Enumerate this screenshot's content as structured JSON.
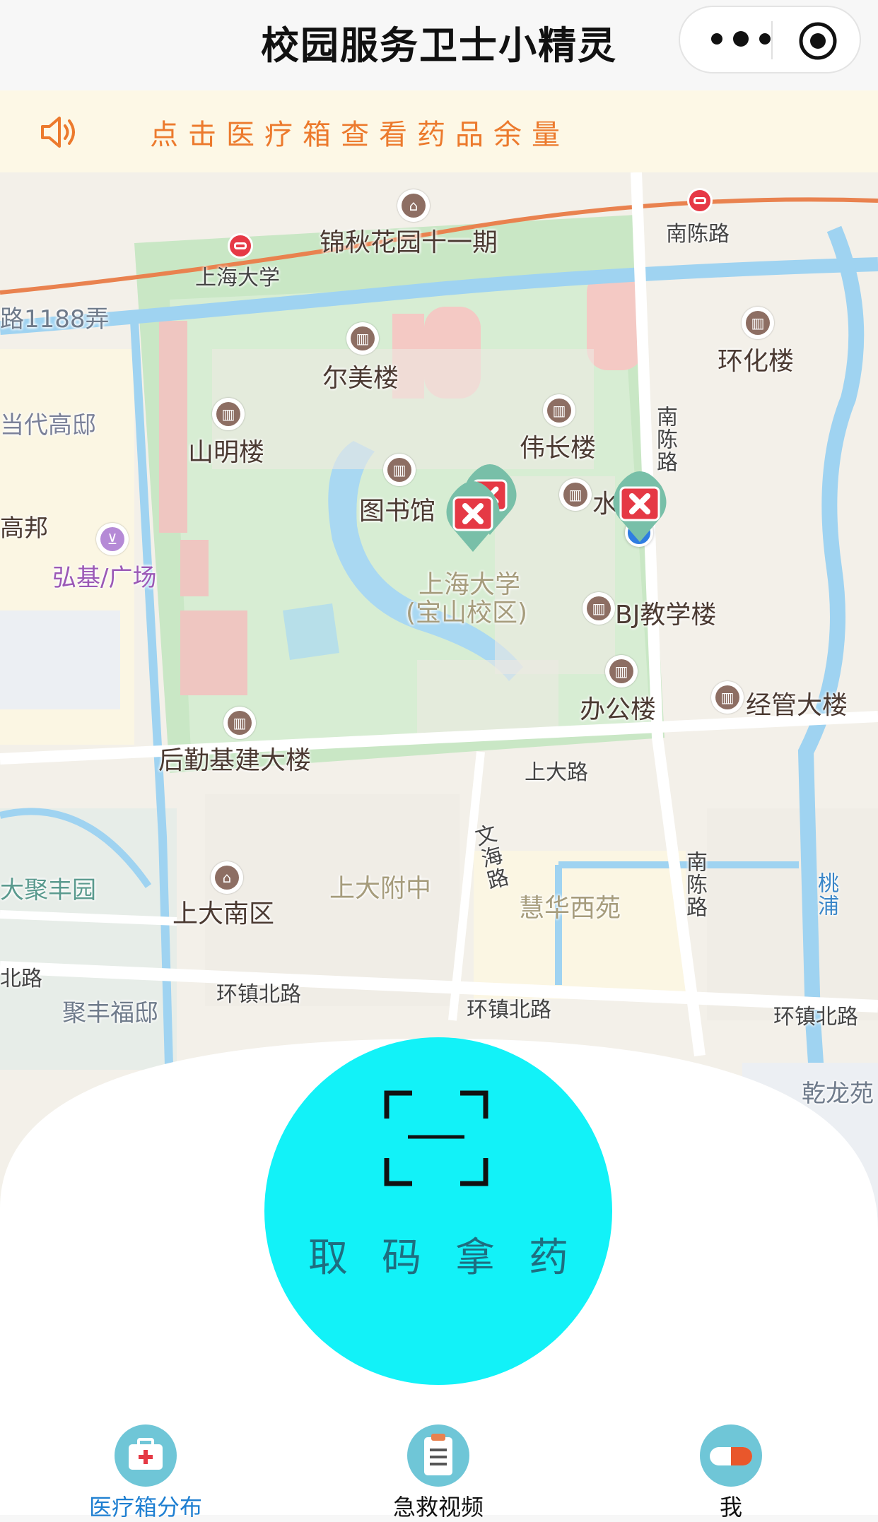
{
  "nav": {
    "title": "校园服务卫士小精灵"
  },
  "notice": {
    "text": "点击医疗箱查看药品余量"
  },
  "map": {
    "roads": {
      "huanzhen_north_left": "环镇北路",
      "huanzhen_north_middle": "环镇北路",
      "huanzhen_north_right": "环镇北路",
      "shangda_road": "上大路",
      "nanchen_road_top": "南陈路",
      "nanchen_road_vertical_upper": "南陈路",
      "nanchen_road_vertical_lower": "南陈路",
      "wenhai_road": "文海路",
      "lane_1188": "路1188弄",
      "left_road_stub": "北路",
      "taopu": "桃浦"
    },
    "places": {
      "jinqiu": "锦秋花园十一期",
      "shu_station": "上海大学",
      "ermei": "尔美楼",
      "shanming": "山明楼",
      "weichang": "伟长楼",
      "library": "图书馆",
      "shui": "水",
      "campus_line1": "上海大学",
      "campus_line2": "(宝山校区)",
      "bj": "BJ教学楼",
      "office": "办公楼",
      "jingguan": "经管大楼",
      "houqin": "后勤基建大楼",
      "huanhua": "环化楼",
      "dangdai": "当代高邸",
      "gaobang": "高邦",
      "hongji": "弘基/广场",
      "shangda_south": "上大南区",
      "shangda_fuzhong": "上大附中",
      "huihua": "慧华西苑",
      "dajufeng": "大聚丰园",
      "jufengfudi": "聚丰福邸",
      "qianlong": "乾龙苑"
    },
    "marker_icon": "first-aid-kit-marker-icon"
  },
  "scan": {
    "label": "取码拿药",
    "icon": "scan-frame-icon"
  },
  "tabbar": {
    "items": [
      {
        "label": "医疗箱分布",
        "icon": "medical-kit-icon",
        "active": true
      },
      {
        "label": "急救视频",
        "icon": "clipboard-list-icon",
        "active": false
      },
      {
        "label": "我",
        "icon": "pill-capsule-icon",
        "active": false
      }
    ],
    "active_color": "#1e7fd1"
  },
  "colors": {
    "scan_circle": "#12f2f8",
    "notice_text": "#ec7a2d",
    "notice_bg": "#fdf8e6"
  }
}
